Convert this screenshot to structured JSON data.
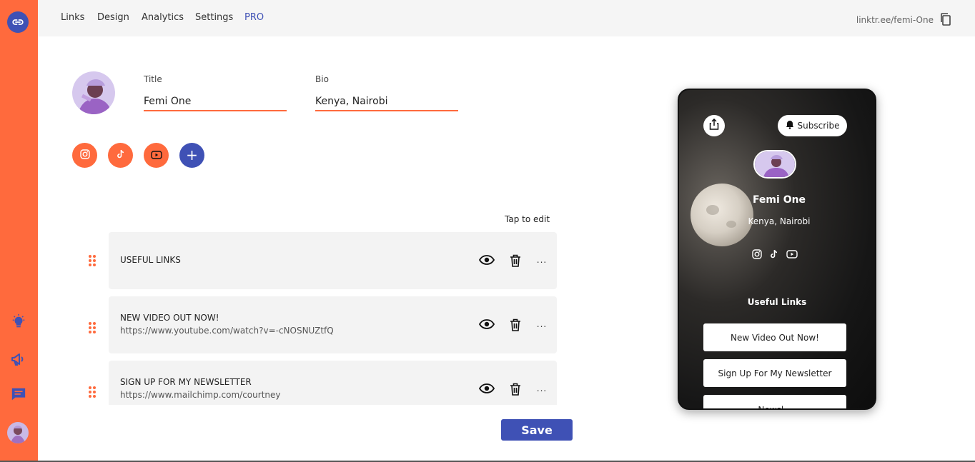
{
  "nav": {
    "items": [
      "Links",
      "Design",
      "Analytics",
      "Settings",
      "PRO"
    ],
    "url": "linktr.ee/femi-One"
  },
  "colors": {
    "accent": "#ff6a3d",
    "brand": "#3f51b5"
  },
  "profile": {
    "title_label": "Title",
    "title_value": "Femi One",
    "bio_label": "Bio",
    "bio_value": "Kenya, Nairobi",
    "socials": [
      "instagram-icon",
      "tiktok-icon",
      "youtube-icon"
    ],
    "add_icon": "+"
  },
  "tap_to_edit": "Tap to edit",
  "links": [
    {
      "title": "USEFUL LINKS",
      "url": ""
    },
    {
      "title": "NEW VIDEO OUT NOW!",
      "url": "https://www.youtube.com/watch?v=-cNOSNUZtfQ"
    },
    {
      "title": "SIGN UP FOR MY NEWSLETTER",
      "url": "https://www.mailchimp.com/courtney"
    }
  ],
  "more_label": "...",
  "save_label": "Save",
  "preview": {
    "subscribe_label": "Subscribe",
    "name": "Femi One",
    "bio": "Kenya, Nairobi",
    "section": "Useful Links",
    "buttons": [
      "New Video Out Now!",
      "Sign Up For My Newsletter",
      "Newsl..."
    ]
  }
}
